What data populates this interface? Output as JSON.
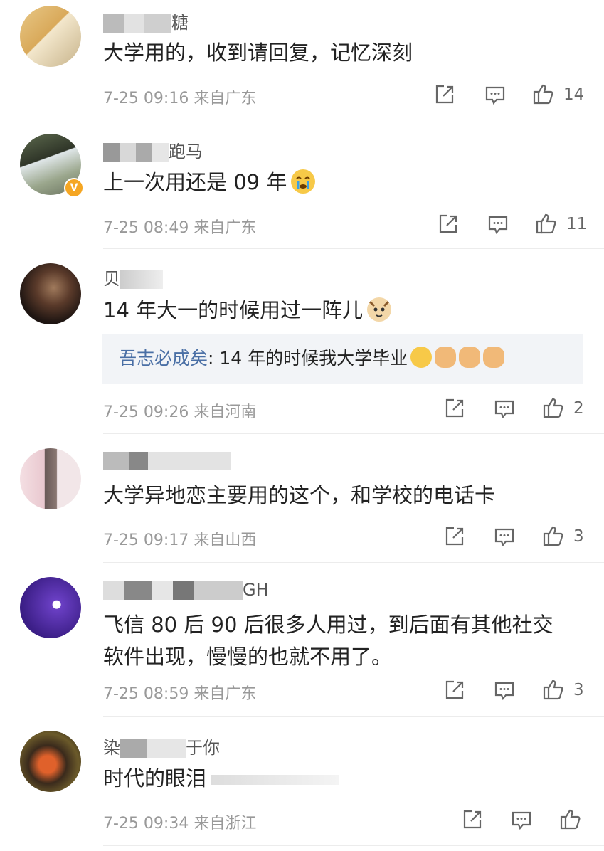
{
  "comments": [
    {
      "username": "糖",
      "text": "大学用的，收到请回复，记忆深刻",
      "time": "7-25 09:16",
      "location": "来自广东",
      "likes": "14"
    },
    {
      "username": "跑马",
      "text": "上一次用还是 09 年",
      "time": "7-25 08:49",
      "location": "来自广东",
      "likes": "11",
      "verified_badge": "V"
    },
    {
      "username": "贝",
      "text": "14 年大一的时候用过一阵儿",
      "time": "7-25 09:26",
      "location": "来自河南",
      "likes": "2",
      "reply": {
        "author": "吾志必成矣",
        "text": ": 14 年的时候我大学毕业"
      }
    },
    {
      "username": "",
      "text": "大学异地恋主要用的这个，和学校的电话卡",
      "time": "7-25 09:17",
      "location": "来自山西",
      "likes": "3"
    },
    {
      "username": "GH",
      "text_line1": "飞信 80 后 90 后很多人用过，到后面有其他社交",
      "text_line2": "软件出现，慢慢的也就不用了。",
      "time": "7-25 08:59",
      "location": "来自广东",
      "likes": "3"
    },
    {
      "username_prefix": "染",
      "username_suffix": "于你",
      "text": "时代的眼泪",
      "time": "7-25 09:34",
      "location": "来自浙江",
      "likes": ""
    }
  ],
  "icons": {
    "share": "share-icon",
    "comment": "comment-icon",
    "like": "thumbs-up-icon",
    "emoji_cry": "crying-emoji",
    "emoji_cat": "cat-emoji",
    "emoji_grin": "grin-emoji",
    "emoji_handshake": "handshake-emoji"
  },
  "colors": {
    "reply_author": "#4a6fa5",
    "meta": "#999999",
    "badge": "#f5a623"
  }
}
